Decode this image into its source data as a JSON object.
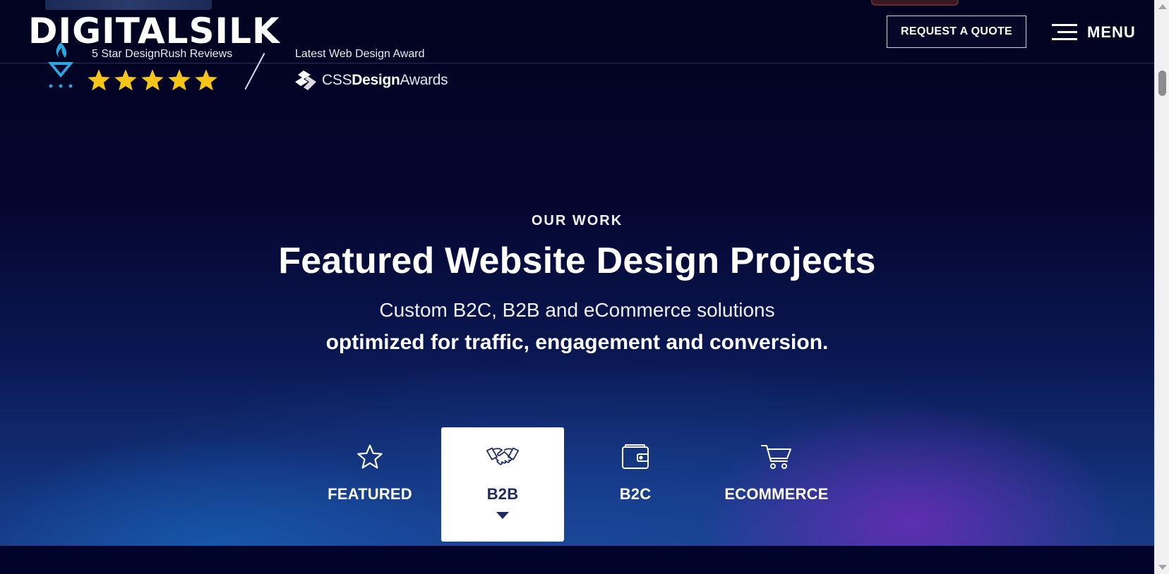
{
  "header": {
    "logo_text": "DIGITALSILK",
    "quote_button": "REQUEST A QUOTE",
    "menu_label": "MENU"
  },
  "awards": {
    "designrush": {
      "title": "5 Star DesignRush Reviews",
      "rating": 5,
      "star_color": "#f5c518"
    },
    "css": {
      "title": "Latest Web Design Award",
      "logo_prefix": "CSS",
      "logo_bold": "Design",
      "logo_suffix": "Awards"
    }
  },
  "hero": {
    "eyebrow": "OUR WORK",
    "title": "Featured Website Design Projects",
    "subtitle_line1": "Custom B2C, B2B and eCommerce solutions",
    "subtitle_line2": "optimized for traffic, engagement and conversion."
  },
  "tabs": [
    {
      "label": "FEATURED",
      "icon": "star-icon",
      "active": false
    },
    {
      "label": "B2B",
      "icon": "handshake-icon",
      "active": true
    },
    {
      "label": "B2C",
      "icon": "wallet-icon",
      "active": false
    },
    {
      "label": "ECOMMERCE",
      "icon": "cart-icon",
      "active": false
    }
  ],
  "colors": {
    "background": "#02042a",
    "active_tab_bg": "#ffffff",
    "active_tab_text": "#1d2a63",
    "accent_blue": "#2aa9e0"
  }
}
